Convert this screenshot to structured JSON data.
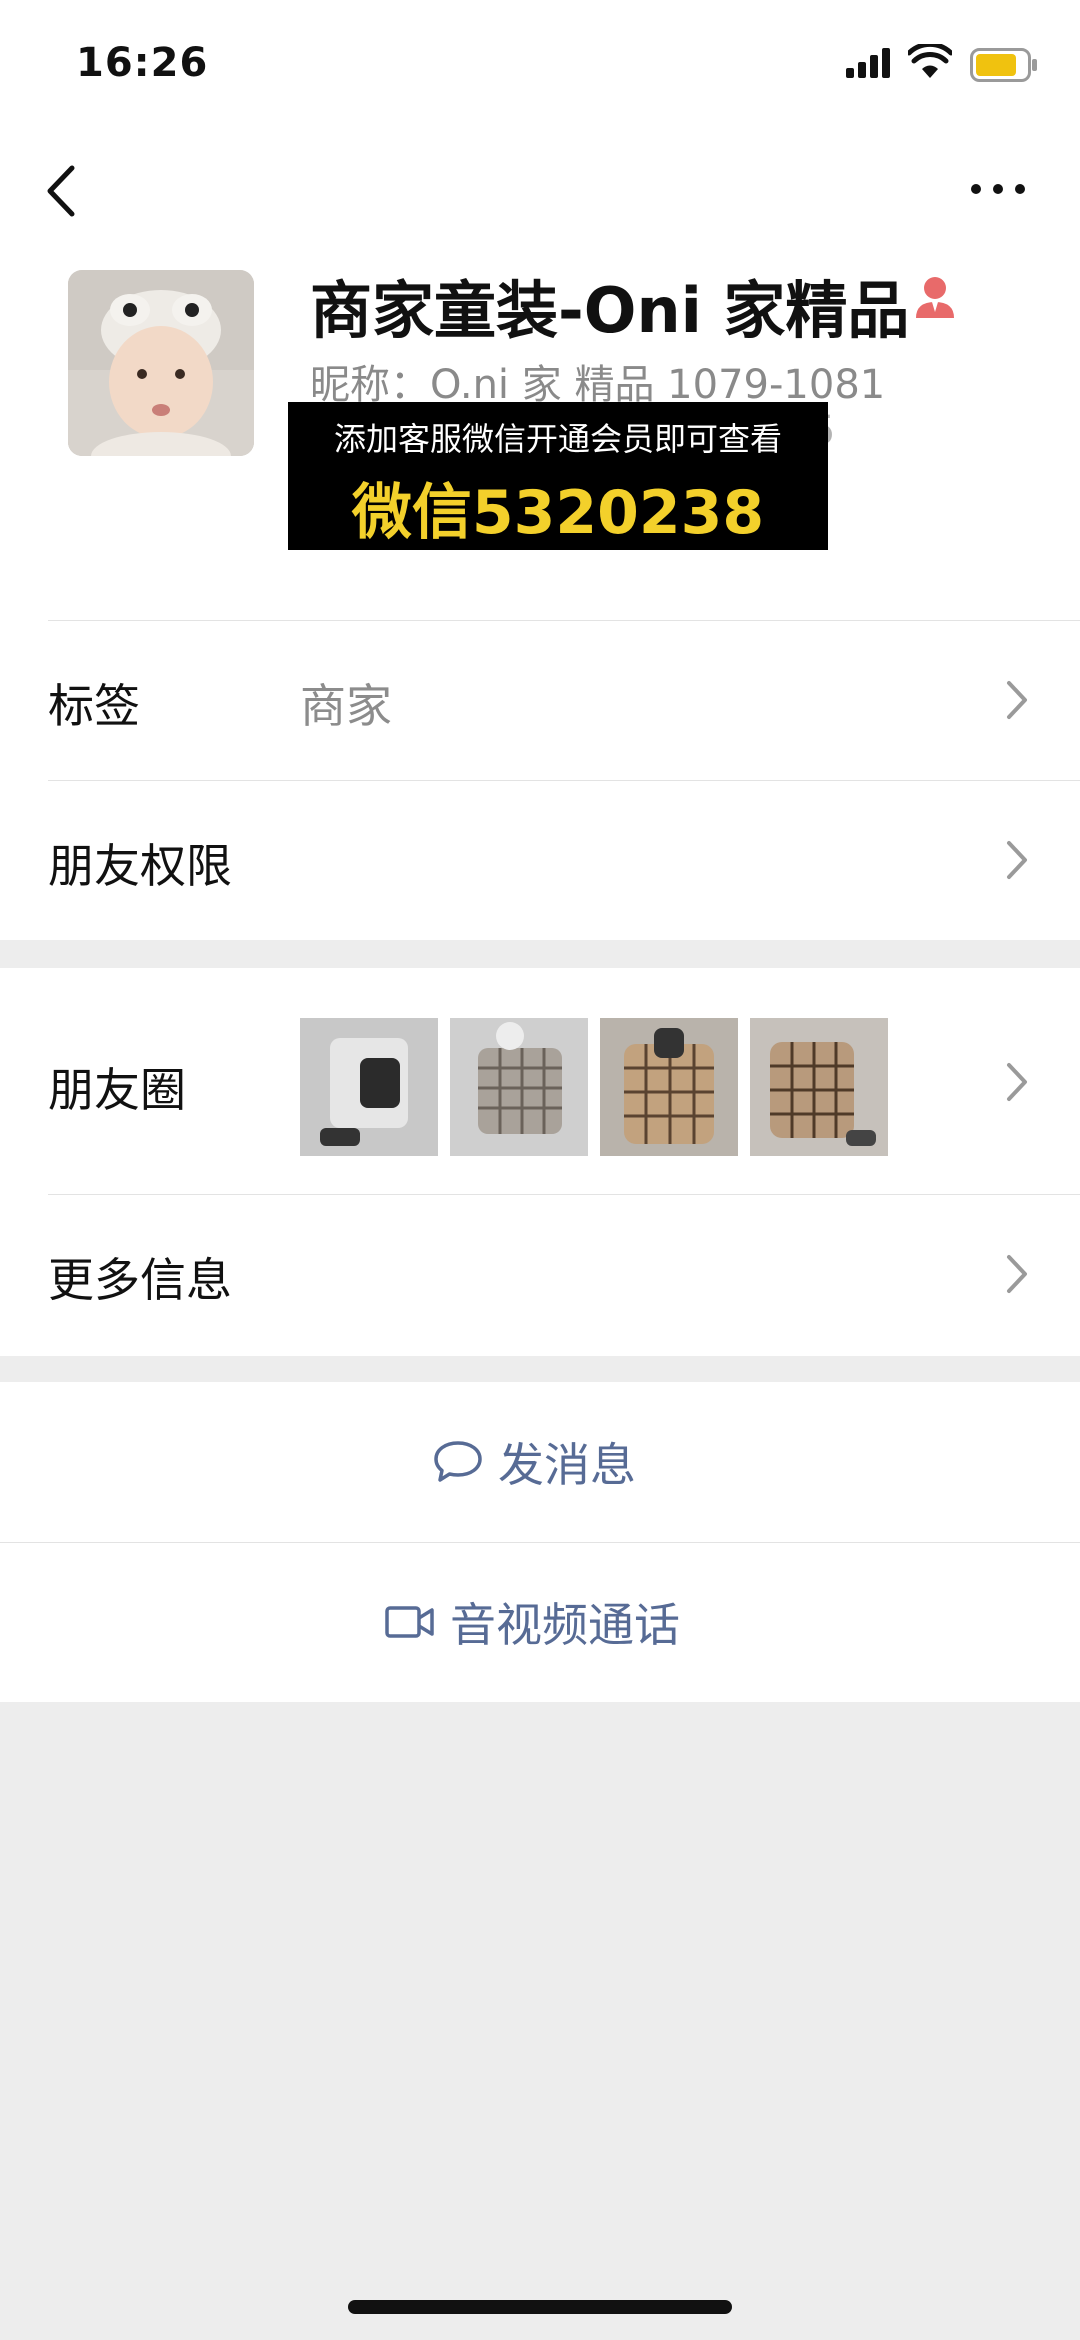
{
  "status_bar": {
    "time": "16:26"
  },
  "profile": {
    "display_name": "商家童装-Oni 家精品",
    "nickname": "昵称：O.ni 家 精品 1079-1081",
    "peek_text": "5",
    "promo_line1": "添加客服微信开通会员即可查看",
    "promo_line2": "微信5320238"
  },
  "rows": {
    "tag_label": "标签",
    "tag_value": "商家",
    "permissions_label": "朋友权限",
    "moments_label": "朋友圈",
    "more_info_label": "更多信息"
  },
  "actions": {
    "message_label": "发消息",
    "call_label": "音视频通话"
  },
  "icons": {
    "back": "chevron-left-icon",
    "more": "more-dots-icon",
    "badge": "person-badge-icon",
    "message": "chat-bubble-icon",
    "call": "video-camera-icon"
  },
  "colors": {
    "link_blue": "#576b95",
    "promo_yellow": "#f3d02b",
    "badge_red": "#e86a6a",
    "background": "#ededed"
  }
}
